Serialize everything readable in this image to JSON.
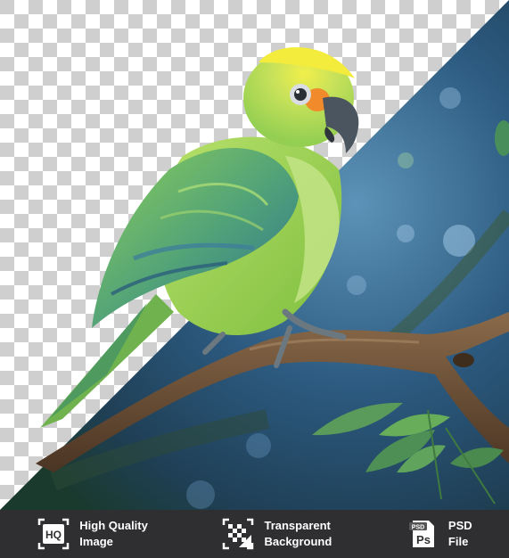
{
  "footer": {
    "features": [
      {
        "icon": "hq-icon",
        "line1": "High Quality",
        "line2": "Image",
        "icon_text": "HQ"
      },
      {
        "icon": "transparent-grid-icon",
        "line1": "Transparent",
        "line2": "Background"
      },
      {
        "icon": "psd-file-icon",
        "line1": "PSD",
        "line2": "File",
        "icon_tag": "PSD",
        "icon_text": "Ps"
      }
    ]
  },
  "colors": {
    "footer_bg": "#2f2f31",
    "parrot_green": "#8fce4a",
    "parrot_yellow": "#e7e23c",
    "sky_blue": "#2d5f86"
  }
}
